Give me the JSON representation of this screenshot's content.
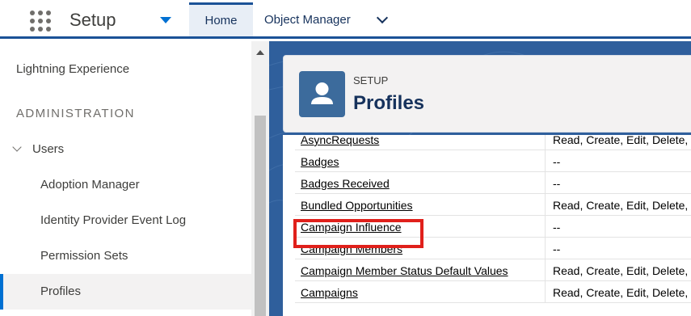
{
  "header": {
    "app_title": "Setup",
    "tabs": [
      {
        "label": "Home",
        "active": true
      },
      {
        "label": "Object Manager",
        "active": false
      }
    ]
  },
  "sidebar": {
    "items": [
      {
        "label": "Lightning Experience"
      },
      {
        "heading": "ADMINISTRATION"
      },
      {
        "label": "Users"
      },
      {
        "label": "Adoption Manager"
      },
      {
        "label": "Identity Provider Event Log"
      },
      {
        "label": "Permission Sets"
      },
      {
        "label": "Profiles",
        "active": true
      }
    ]
  },
  "page": {
    "eyebrow": "SETUP",
    "title": "Profiles",
    "icon": "profile-icon"
  },
  "table": {
    "rows": [
      {
        "name": "AsyncRequests",
        "permissions": "Read, Create, Edit, Delete,"
      },
      {
        "name": "Badges",
        "permissions": "--"
      },
      {
        "name": "Badges Received",
        "permissions": "--"
      },
      {
        "name": "Bundled Opportunities",
        "permissions": "Read, Create, Edit, Delete,"
      },
      {
        "name": "Campaign Influence",
        "permissions": "--",
        "highlighted": true
      },
      {
        "name": "Campaign Members",
        "permissions": "--"
      },
      {
        "name": "Campaign Member Status Default Values",
        "permissions": "Read, Create, Edit, Delete,"
      },
      {
        "name": "Campaigns",
        "permissions": "Read, Create, Edit, Delete,"
      }
    ]
  },
  "colors": {
    "brand_blue": "#1b5297",
    "accent": "#0070d2",
    "highlight_red": "#e0201b"
  }
}
